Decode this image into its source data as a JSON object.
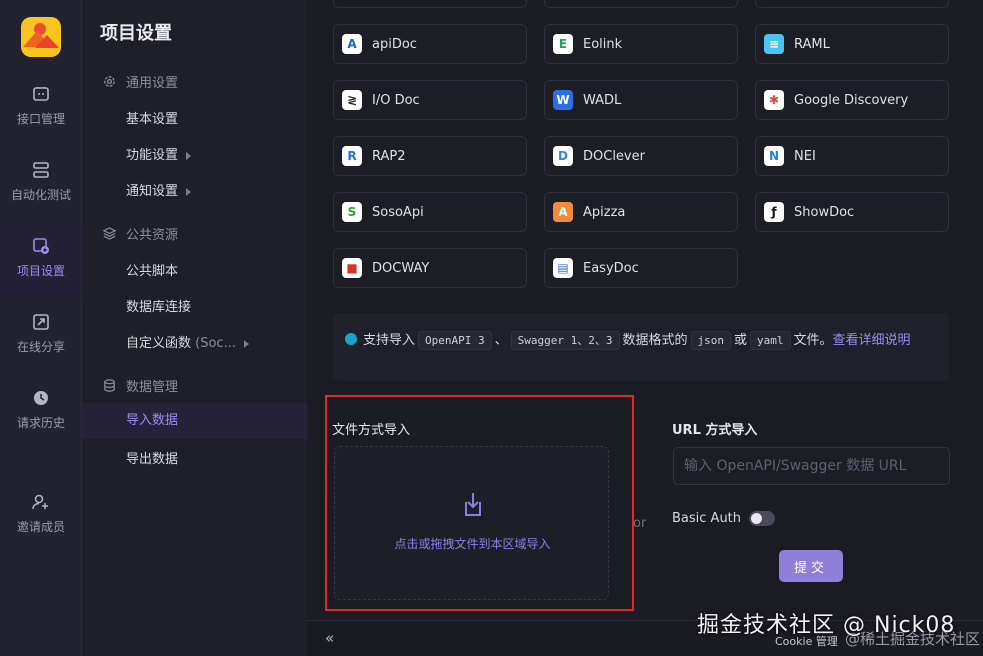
{
  "rail": {
    "items": [
      {
        "label": "接口管理",
        "icon": "api-box-icon"
      },
      {
        "label": "自动化测试",
        "icon": "automation-icon"
      },
      {
        "label": "项目设置",
        "icon": "settings-gear-icon"
      },
      {
        "label": "在线分享",
        "icon": "share-icon"
      },
      {
        "label": "请求历史",
        "icon": "history-icon"
      },
      {
        "label": "邀请成员",
        "icon": "invite-user-icon"
      }
    ]
  },
  "sidebar": {
    "title": "项目设置",
    "groups": [
      {
        "label": "通用设置",
        "icon": "gear-icon"
      },
      {
        "label": "公共资源",
        "icon": "layers-icon"
      },
      {
        "label": "数据管理",
        "icon": "database-icon"
      }
    ],
    "items": {
      "basic": "基本设置",
      "feature": "功能设置",
      "notify": "通知设置",
      "script": "公共脚本",
      "db": "数据库连接",
      "func": "自定义函数",
      "func_extra": "(Soc...",
      "import": "导入数据",
      "export": "导出数据"
    }
  },
  "sources": [
    {
      "name": "apiDoc",
      "color": "#ffffff",
      "fg": "#1f5fd6",
      "glyph": "A"
    },
    {
      "name": "Eolink",
      "color": "#ffffff",
      "fg": "#1aa06a",
      "glyph": "E"
    },
    {
      "name": "RAML",
      "color": "#4dc3f0",
      "fg": "#ffffff",
      "glyph": "≡"
    },
    {
      "name": "I/O Doc",
      "color": "#ffffff",
      "fg": "#222222",
      "glyph": "≷"
    },
    {
      "name": "WADL",
      "color": "#2d6fe0",
      "fg": "#ffffff",
      "glyph": "W"
    },
    {
      "name": "Google Discovery",
      "color": "#ffffff",
      "fg": "#e8453c",
      "glyph": "✱"
    },
    {
      "name": "RAP2",
      "color": "#ffffff",
      "fg": "#2f6ddc",
      "glyph": "R"
    },
    {
      "name": "DOClever",
      "color": "#ffffff",
      "fg": "#2f8be0",
      "glyph": "D"
    },
    {
      "name": "NEI",
      "color": "#ffffff",
      "fg": "#2a7de0",
      "glyph": "N"
    },
    {
      "name": "SosoApi",
      "color": "#ffffff",
      "fg": "#3a9a3a",
      "glyph": "S"
    },
    {
      "name": "Apizza",
      "color": "#f08a3c",
      "fg": "#ffffff",
      "glyph": "A"
    },
    {
      "name": "ShowDoc",
      "color": "#ffffff",
      "fg": "#111111",
      "glyph": "ƒ"
    },
    {
      "name": "DOCWAY",
      "color": "#ffffff",
      "fg": "#d8342c",
      "glyph": "■"
    },
    {
      "name": "EasyDoc",
      "color": "#ffffff",
      "fg": "#3a6fd0",
      "glyph": "▤"
    }
  ],
  "info": {
    "t1": "支持导入",
    "c1": "OpenAPI 3",
    "sep": "、",
    "c2": "Swagger 1、2、3",
    "t2": "数据格式的",
    "c3": "json",
    "t3": "或",
    "c4": "yaml",
    "t4": "文件。",
    "link": "查看详细说明"
  },
  "file_import": {
    "title": "文件方式导入",
    "hint": "点击或拖拽文件到本区域导入"
  },
  "or_label": "or",
  "url_import": {
    "title": "URL 方式导入",
    "placeholder": "输入 OpenAPI/Swagger 数据 URL",
    "basic_auth": "Basic Auth",
    "basic_auth_on": false,
    "submit": "提交"
  },
  "footer": {
    "collapse": "«",
    "cookie": "Cookie 管理"
  },
  "watermark": "掘金技术社区 @ Nick08",
  "watermark_sub": "@稀土掘金技术社区"
}
